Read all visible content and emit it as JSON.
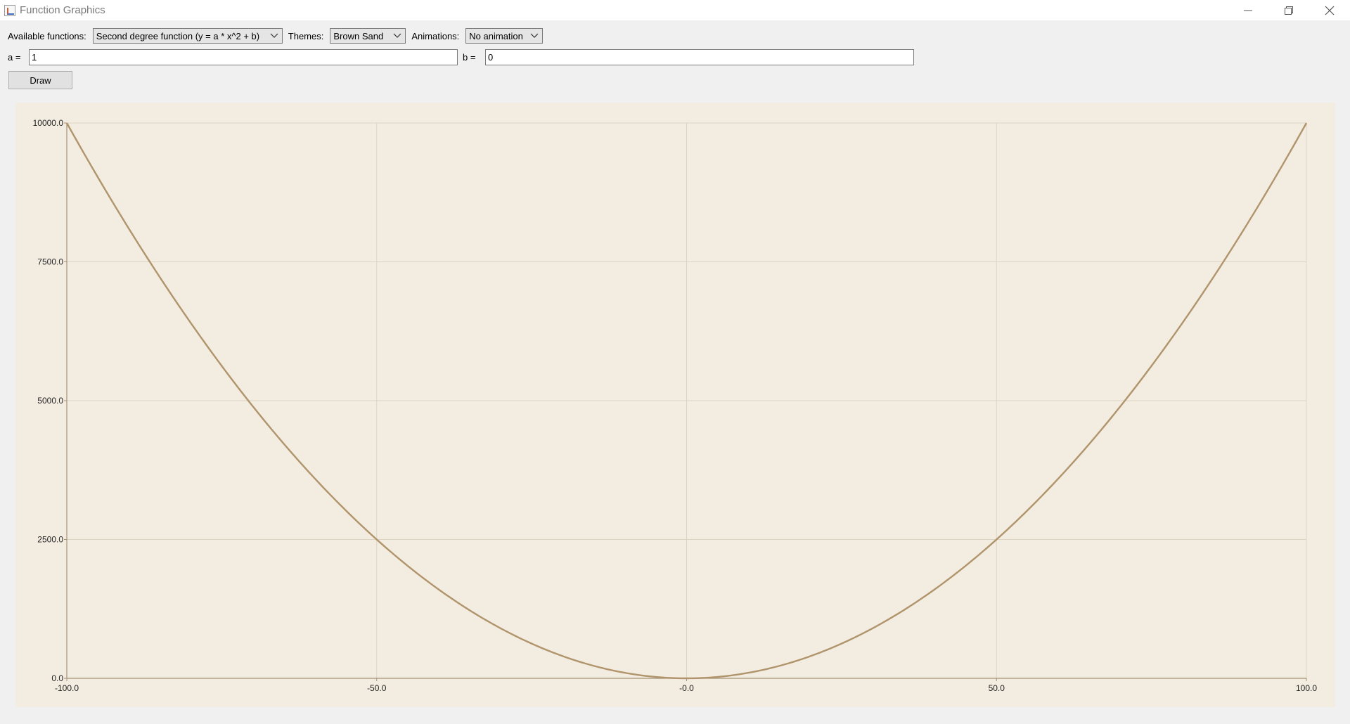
{
  "window": {
    "title": "Function Graphics",
    "icons": {
      "app": "chart-app-icon",
      "minimize": "minimize-icon",
      "maximize": "restore-icon",
      "close": "close-icon"
    }
  },
  "controls": {
    "functions_label": "Available functions:",
    "functions_value": "Second degree function (y = a * x^2 + b)",
    "themes_label": "Themes:",
    "themes_value": "Brown Sand",
    "animations_label": "Animations:",
    "animations_value": "No animation",
    "a_label": "a =",
    "a_value": "1",
    "b_label": "b =",
    "b_value": "0",
    "draw_label": "Draw"
  },
  "colors": {
    "plot_background": "#f3ece1",
    "curve": "#b0946b",
    "grid": "#ddd3c3",
    "axis": "#a59174"
  },
  "chart_data": {
    "type": "line",
    "title": "",
    "xlabel": "",
    "ylabel": "",
    "xlim": [
      -100,
      100
    ],
    "ylim": [
      0,
      10000
    ],
    "x_ticks": [
      "-100.0",
      "-50.0",
      "-0.0",
      "50.0",
      "100.0"
    ],
    "y_ticks": [
      "0.0",
      "2500.0",
      "5000.0",
      "7500.0",
      "10000.0"
    ],
    "grid": true,
    "legend": "none",
    "series": [
      {
        "function": "y = a * x^2 + b",
        "a": 1,
        "b": 0,
        "x": [
          -100,
          -90,
          -80,
          -70,
          -60,
          -50,
          -40,
          -30,
          -20,
          -10,
          0,
          10,
          20,
          30,
          40,
          50,
          60,
          70,
          80,
          90,
          100
        ],
        "values": [
          10000,
          8100,
          6400,
          4900,
          3600,
          2500,
          1600,
          900,
          400,
          100,
          0,
          100,
          400,
          900,
          1600,
          2500,
          3600,
          4900,
          6400,
          8100,
          10000
        ]
      }
    ]
  }
}
